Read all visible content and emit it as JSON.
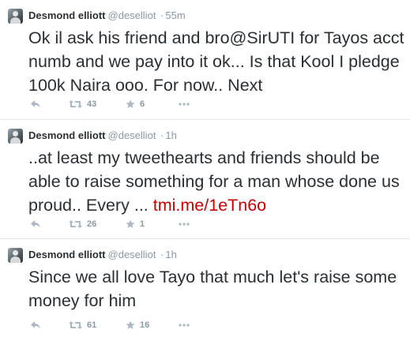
{
  "tweets": [
    {
      "name": "Desmond elliott",
      "handle": "@deselliot",
      "separator": "·",
      "time": "55m",
      "text": "Ok il ask his friend and bro@SirUTI for Tayos acct numb and we pay into it ok... Is that Kool I pledge 100k Naira ooo. For now.. Next",
      "link": "",
      "retweets": "43",
      "favorites": "6"
    },
    {
      "name": "Desmond elliott",
      "handle": "@deselliot",
      "separator": "·",
      "time": "1h",
      "text": "..at least my tweethearts and friends should be able to raise something for a man whose done us proud.. Every ... ",
      "link": "tmi.me/1eTn6o",
      "retweets": "26",
      "favorites": "1"
    },
    {
      "name": "Desmond elliott",
      "handle": "@deselliot",
      "separator": "·",
      "time": "1h",
      "text": "Since we all love Tayo that much let's raise some money for him",
      "link": "",
      "retweets": "61",
      "favorites": "16"
    }
  ],
  "icons": {
    "reply": "reply-icon",
    "retweet": "retweet-icon",
    "favorite": "star-icon",
    "more": "more-icon"
  },
  "colors": {
    "text": "#292f33",
    "muted": "#8899a6",
    "link": "#cc0000",
    "divider": "#e1e8ed"
  }
}
